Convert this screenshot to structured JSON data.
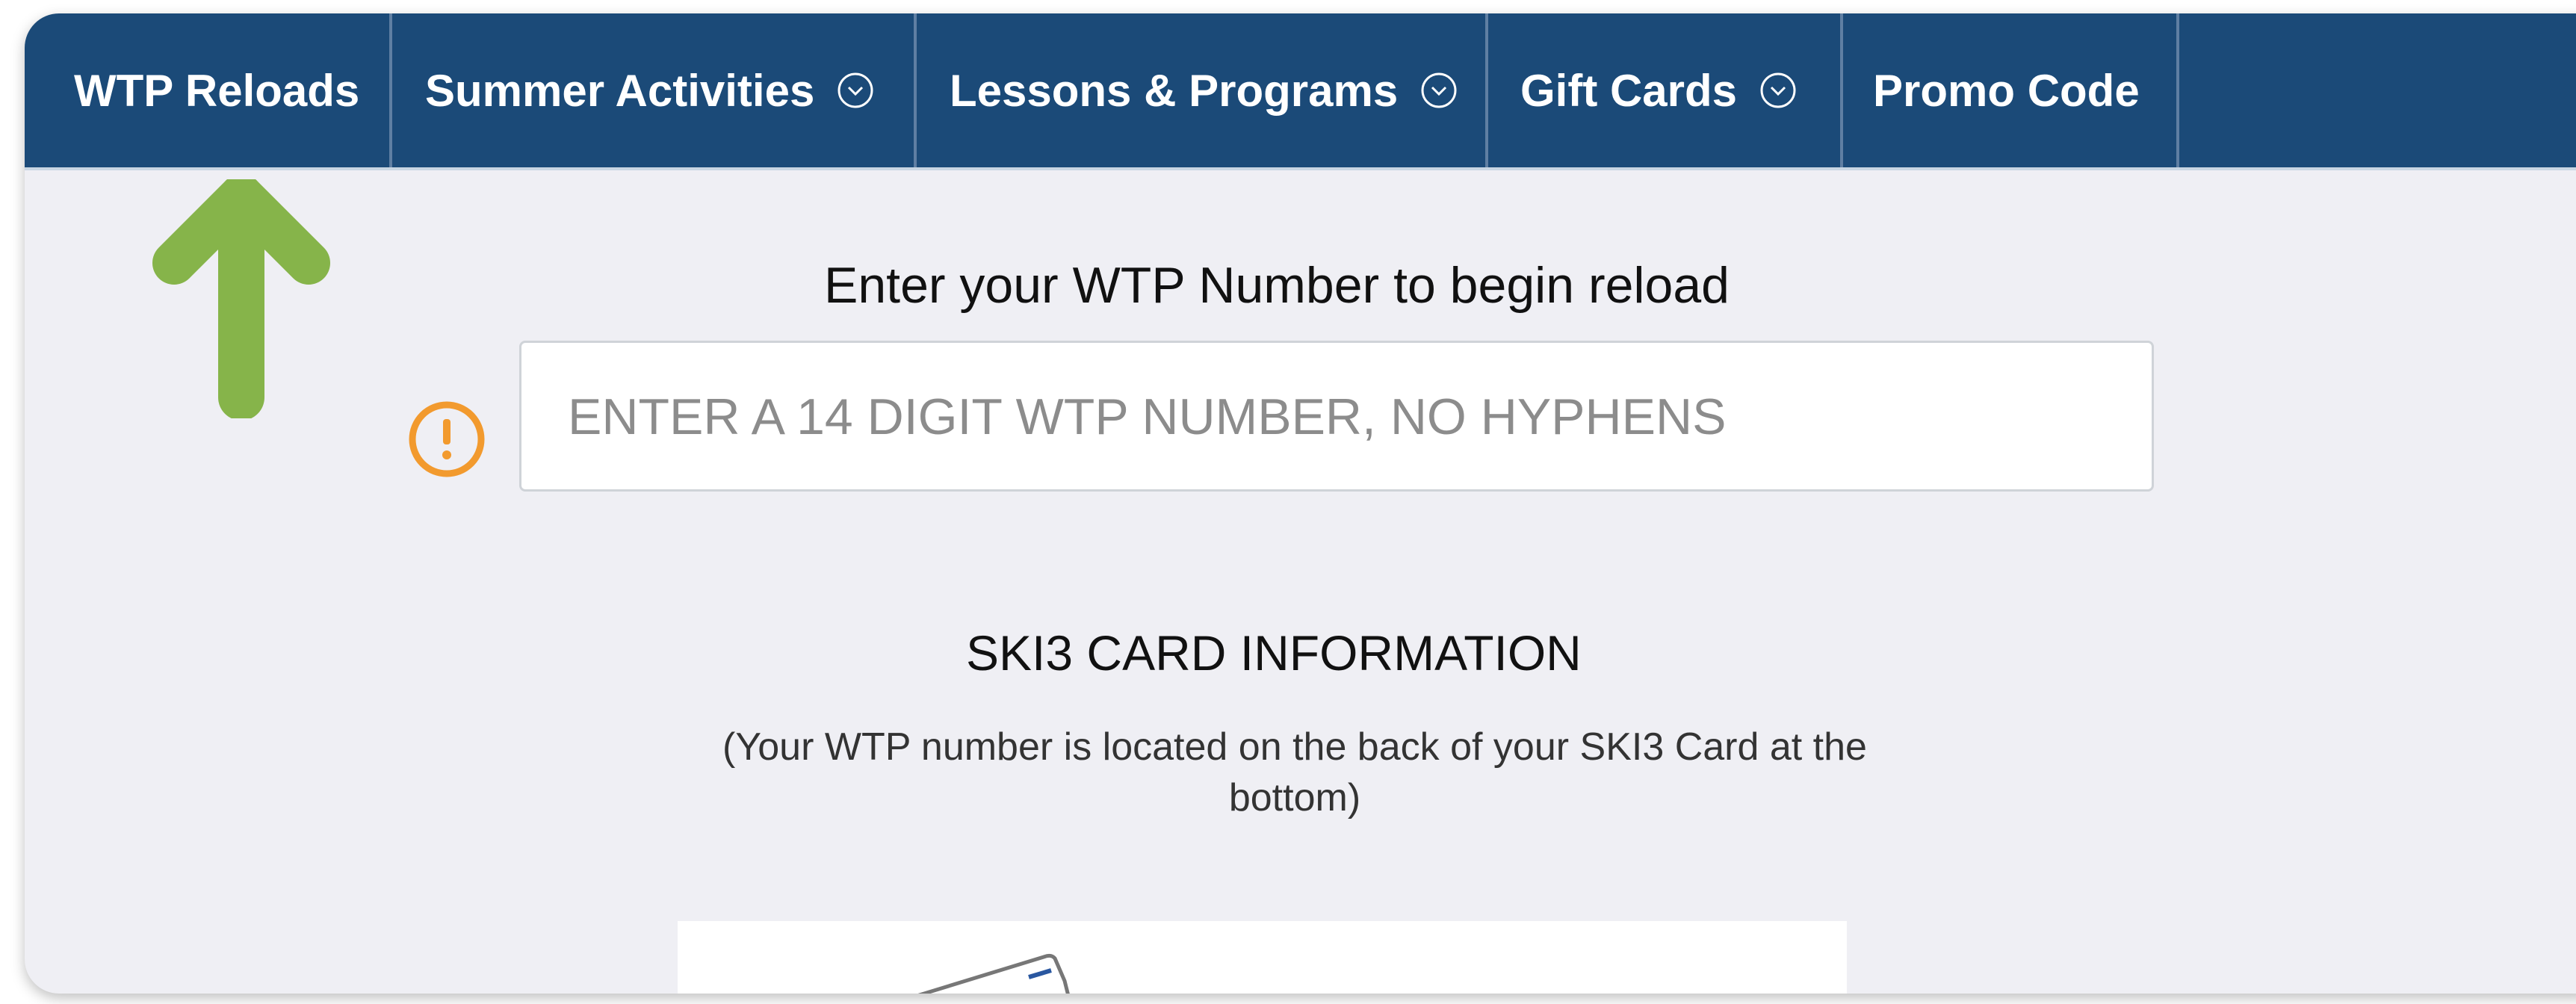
{
  "nav": {
    "items": [
      {
        "label": "WTP Reloads",
        "has_dropdown": false
      },
      {
        "label": "Summer Activities",
        "has_dropdown": true
      },
      {
        "label": "Lessons & Programs",
        "has_dropdown": true
      },
      {
        "label": "Gift Cards",
        "has_dropdown": true
      },
      {
        "label": "Promo Code",
        "has_dropdown": false
      }
    ]
  },
  "main": {
    "heading": "Enter your WTP Number to begin reload",
    "wtp_input": {
      "value": "",
      "placeholder": "ENTER A 14 DIGIT WTP NUMBER, NO HYPHENS"
    },
    "card_info_title": "SKI3 CARD INFORMATION",
    "card_info_text": "(Your WTP number is located on the back of your SKI3 Card at the bottom)"
  },
  "colors": {
    "nav_bg": "#1b4a78",
    "page_bg": "#efeff4",
    "arrow": "#86b44a",
    "warning": "#f29a2e"
  },
  "icons": {
    "annotation": "green-up-arrow-icon",
    "validation": "warning-circle-icon",
    "dropdown": "chevron-down-circle-icon"
  }
}
